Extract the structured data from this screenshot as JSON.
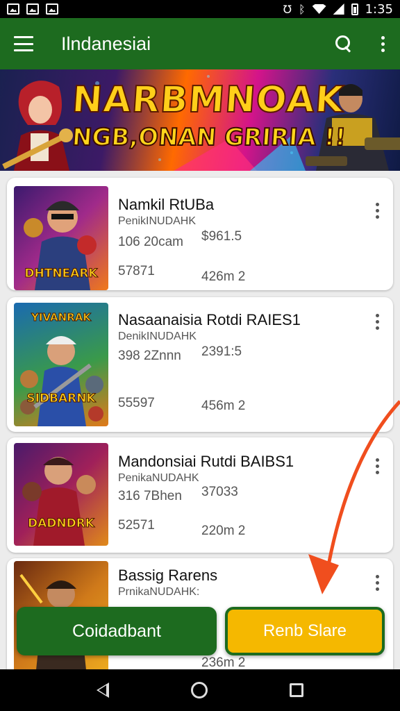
{
  "status_bar": {
    "time": "1:35",
    "left_icons": [
      "photo-notification-icon",
      "gallery-notification-icon",
      "image-notification-icon"
    ],
    "right_icons": [
      "nfc-icon",
      "bluetooth-icon",
      "wifi-icon",
      "signal-icon",
      "battery-icon"
    ]
  },
  "app_bar": {
    "title": "Ilndanesiai",
    "background": "#1d6b1f"
  },
  "banner": {
    "line1": "NARBMNOAK",
    "line2": "NGB,ONAN GRIRIA !!"
  },
  "items": [
    {
      "title": "Namkil RtUBa",
      "subtitle": "PenikINUDAHK",
      "meta_left_1": "106 20cam",
      "meta_right_1": "$961.5",
      "meta_left_2": "57871",
      "meta_right_2": "426m 2",
      "thumb_caption": "DHTNEARK",
      "thumb_top": ""
    },
    {
      "title": "Nasaanaisia  Rotdi RAIES1",
      "subtitle": "DenikINUDAHK",
      "meta_left_1": "398 2Znnn",
      "meta_right_1": "2391:5",
      "meta_left_2": "55597",
      "meta_right_2": "456m 2",
      "thumb_caption": "SIDBARNK",
      "thumb_top": "YIVANRAK"
    },
    {
      "title": "Mandonsiai  Rutdi BAIBS1",
      "subtitle": "PenikaNUDAHK",
      "meta_left_1": "316 7Bhen",
      "meta_right_1": "37033",
      "meta_left_2": "52571",
      "meta_right_2": "220m 2",
      "thumb_caption": "DADNDRK",
      "thumb_top": ""
    },
    {
      "title": "Bassig Rarens",
      "subtitle": "PrnikaNUDAHK:",
      "meta_left_1": "",
      "meta_right_1": "",
      "meta_left_2": "",
      "meta_right_2": "236m 2",
      "thumb_caption": "",
      "thumb_top": ""
    }
  ],
  "actions": {
    "download_label": "Coidadbant",
    "share_label": "Renb Slare",
    "download_color": "#1d6b1f",
    "share_color": "#f5b800",
    "arrow_color": "#f04e1e"
  },
  "nav_bar": {
    "icons": [
      "back-icon",
      "home-icon",
      "recents-icon"
    ]
  }
}
